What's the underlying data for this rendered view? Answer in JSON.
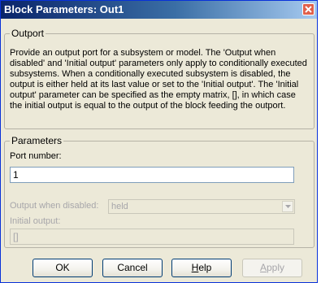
{
  "window": {
    "title": "Block Parameters: Out1"
  },
  "outport": {
    "label": "Outport",
    "description": "Provide an output port for a subsystem or model.  The 'Output when disabled' and 'Initial output' parameters only apply to conditionally executed subsystems. When a conditionally executed subsystem is disabled, the output is either held at its last value or set to the 'Initial output'. The 'Initial output' parameter can be specified as the empty matrix, [], in which case the initial output is equal to the output of the block feeding the outport."
  },
  "parameters": {
    "label": "Parameters",
    "port_number_label": "Port number:",
    "port_number_value": "1",
    "output_disabled_label": "Output when disabled:",
    "output_disabled_value": "held",
    "initial_output_label": "Initial output:",
    "initial_output_value": "[]"
  },
  "buttons": {
    "ok": "OK",
    "cancel": "Cancel",
    "help_first": "H",
    "help_rest": "elp",
    "apply_first": "A",
    "apply_rest": "pply"
  }
}
